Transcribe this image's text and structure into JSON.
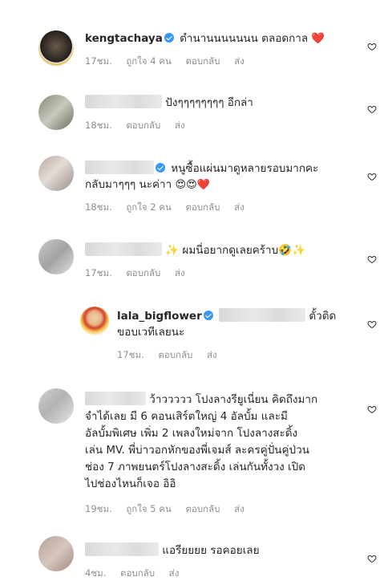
{
  "comments": [
    {
      "username": "kengtachaya",
      "verified": true,
      "text": "ตำนานนนนนนน ตลอดกาล",
      "emoji": "❤️",
      "time": "17ชม.",
      "likes": "ถูกใจ 4 คน",
      "reply": "ตอบกลับ",
      "send": "ส่ง"
    },
    {
      "text": "ปังๆๆๆๆๆๆๆๆ อีกล่า",
      "time": "18ชม.",
      "reply": "ตอบกลับ",
      "send": "ส่ง"
    },
    {
      "verified": true,
      "text_line1": "หนูซื้อแผ่นมาดูหลายรอบมากคะ",
      "text_line2": "กลับมาๆๆๆ นะค่าา",
      "emoji": "😍😍❤️",
      "time": "18ชม.",
      "likes": "ถูกใจ 2 คน",
      "reply": "ตอบกลับ",
      "send": "ส่ง"
    },
    {
      "text": "ผมนี่อยากดูเลยคร้าบ",
      "emoji_pre": "✨",
      "emoji_post": "🤣✨",
      "time": "17ชม.",
      "reply": "ตอบกลับ",
      "send": "ส่ง"
    },
    {
      "username": "lala_bigflower",
      "verified": true,
      "text_line1": "ตั้วติด",
      "text_line2": "ขอบเวทีเลยนะ",
      "time": "17ชม.",
      "reply": "ตอบกลับ",
      "send": "ส่ง"
    },
    {
      "lines": [
        "ว้าววววว โปงลางรียูเนี่ยน คิดถึงมาก",
        "จำได้เลย มี 6 คอนเสิร์ตใหญ่ 4 อัลบั้ม และมี",
        "อัลบั้มพิเศษ เพิ่ม 2 เพลงใหม่จาก โปงลางสะดิ้ง",
        "เล่น MV. พี่บ่าวอกหักของพี่เจมส์ ละครคู่ปั่นคู่ป่วน",
        "ช่อง 7 ภาพยนตร์โปงลางสะดิ้ง เล่นกันทั้งวง เปิด",
        "ไปช่องไหนก็เจอ อิอิ"
      ],
      "time": "19ชม.",
      "likes": "ถูกใจ 5 คน",
      "reply": "ตอบกลับ",
      "send": "ส่ง"
    },
    {
      "text": "แอรียยยย รอคอยเลย",
      "time": "4ชม.",
      "reply": "ตอบกลับ",
      "send": "ส่ง"
    }
  ],
  "colors": {
    "text": "#262626",
    "meta": "#8e8e8e",
    "verified": "#3897f0",
    "heart_emoji": "#ed4956"
  }
}
